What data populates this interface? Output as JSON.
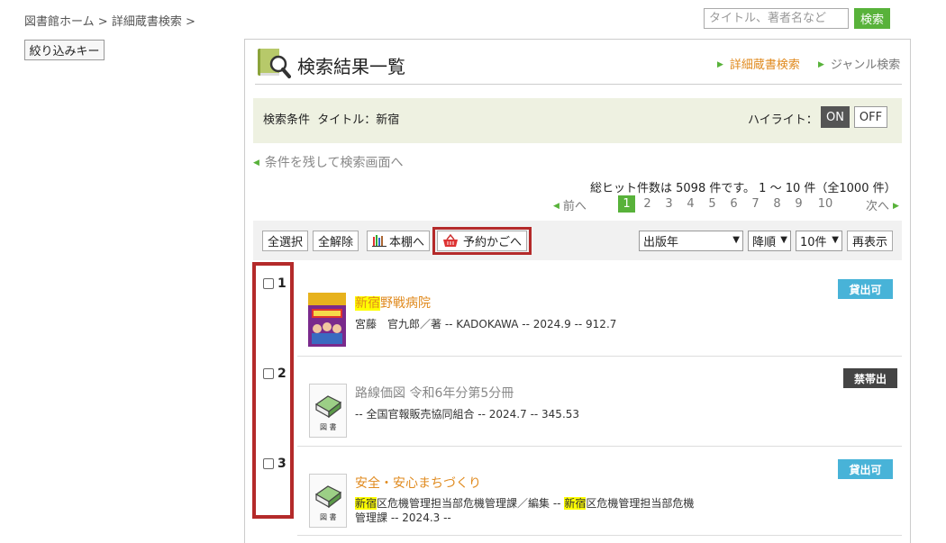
{
  "breadcrumb": {
    "home": "図書館ホーム",
    "sep1": ">",
    "current": "詳細蔵書検索",
    "sep2": ">"
  },
  "header_search": {
    "placeholder": "タイトル、著者名など",
    "button": "検索"
  },
  "sidebar": {
    "filter_key_label": "絞り込みキー"
  },
  "page": {
    "title": "検索結果一覧",
    "link_advanced": "詳細蔵書検索",
    "link_genre": "ジャンル検索"
  },
  "conditions": {
    "label": "検索条件",
    "value": "タイトル：新宿",
    "highlight_label": "ハイライト：",
    "highlight_on": "ON",
    "highlight_off": "OFF"
  },
  "back_link": "条件を残して検索画面へ",
  "results_summary": "総ヒット件数は 5098 件です。 1 ～ 10 件（全1000 件）",
  "pager": {
    "prev": "前へ",
    "next": "次へ",
    "pages": [
      "1",
      "2",
      "3",
      "4",
      "5",
      "6",
      "7",
      "8",
      "9",
      "10"
    ],
    "current": "1"
  },
  "toolbar": {
    "select_all": "全選択",
    "deselect_all": "全解除",
    "bookshelf": "本棚へ",
    "reserve_basket": "予約かごへ",
    "sort_field": "出版年",
    "sort_order": "降順",
    "per_page": "10件",
    "redisplay": "再表示"
  },
  "results": [
    {
      "num": "1",
      "title_hl": "新宿",
      "title_rest": "野戦病院",
      "meta": "宮藤　官九郎／著 -- KADOKAWA -- 2024.9 -- 912.7",
      "status": "貸出可",
      "status_color": "#48b3d8",
      "title_color": "#e08a1e"
    },
    {
      "num": "2",
      "title": "路線価図 令和6年分第5分冊",
      "meta": "-- 全国官報販売協同組合 -- 2024.7 -- 345.53",
      "status": "禁帯出",
      "status_color": "#444444",
      "title_color": "#888888",
      "thumb_label": "図 書"
    },
    {
      "num": "3",
      "title": "安全・安心まちづくり",
      "meta_hl1": "新宿",
      "meta_mid": "区危機管理担当部危機管理課／編集 -- ",
      "meta_hl2": "新宿",
      "meta_rest1": "区危機管理担当部危機",
      "meta_rest2": "管理課 -- 2024.3 --",
      "status": "貸出可",
      "status_color": "#48b3d8",
      "title_color": "#e08a1e",
      "thumb_label": "図 書"
    }
  ],
  "colors": {
    "accent_green": "#58b23a",
    "link_orange": "#e08a1e",
    "highlight_red_outline": "#b42a2a"
  }
}
